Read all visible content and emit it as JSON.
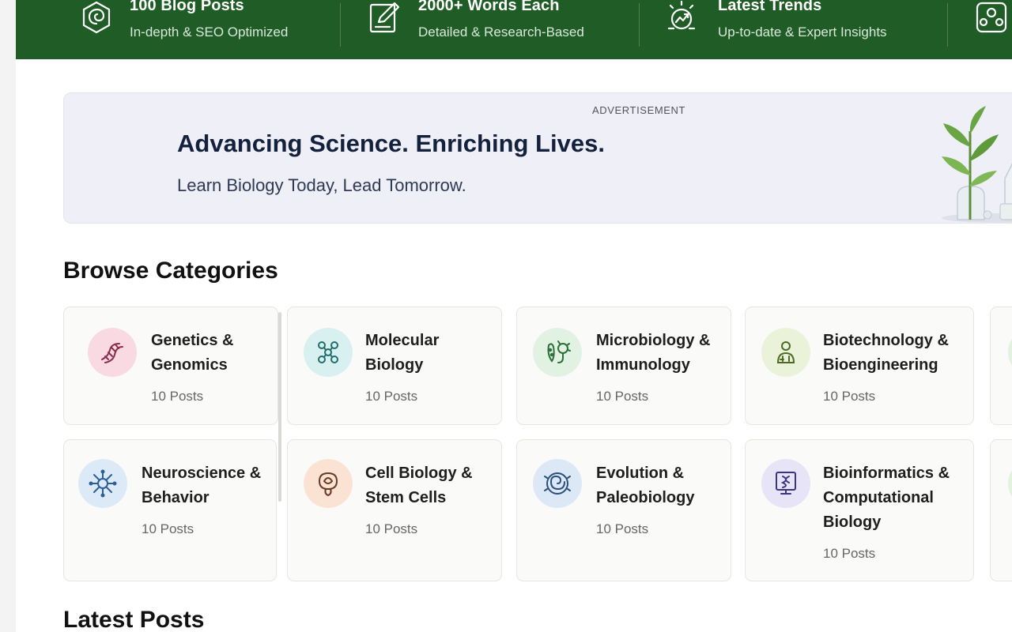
{
  "features": [
    {
      "title": "100 Blog Posts",
      "subtitle": "In-depth & SEO Optimized",
      "icon": "spiral-hexagon-icon"
    },
    {
      "title": "2000+ Words Each",
      "subtitle": "Detailed & Research-Based",
      "icon": "edit-document-icon"
    },
    {
      "title": "Latest Trends",
      "subtitle": "Up-to-date & Expert Insights",
      "icon": "trend-arrows-icon"
    },
    {
      "title": "",
      "subtitle": "",
      "icon": "community-icon"
    }
  ],
  "ad": {
    "label": "ADVERTISEMENT",
    "title": "Advancing Science. Enriching Lives.",
    "subtitle": "Learn Biology Today, Lead Tomorrow."
  },
  "categories_title": "Browse Categories",
  "categories": [
    {
      "name": "Genetics & Genomics",
      "posts": "10 Posts",
      "icon": "dna-icon",
      "color": "#f9d9e2"
    },
    {
      "name": "Molecular Biology",
      "posts": "10 Posts",
      "icon": "molecule-icon",
      "color": "#d8f0ef"
    },
    {
      "name": "Microbiology & Immunology",
      "posts": "10 Posts",
      "icon": "microbe-icon",
      "color": "#e1f2e3"
    },
    {
      "name": "Biotechnology & Bioengineering",
      "posts": "10 Posts",
      "icon": "scientist-icon",
      "color": "#eaf3d9"
    },
    {
      "name": "Neuroscience & Behavior",
      "posts": "10 Posts",
      "icon": "neuron-icon",
      "color": "#dceaf8"
    },
    {
      "name": "Cell Biology & Stem Cells",
      "posts": "10 Posts",
      "icon": "cell-icon",
      "color": "#fbe3d3"
    },
    {
      "name": "Evolution & Paleobiology",
      "posts": "10 Posts",
      "icon": "fossil-icon",
      "color": "#dde8f6"
    },
    {
      "name": "Bioinformatics & Computational Biology",
      "posts": "10 Posts",
      "icon": "computer-dna-icon",
      "color": "#e6e4f6"
    }
  ],
  "latest_title": "Latest Posts"
}
